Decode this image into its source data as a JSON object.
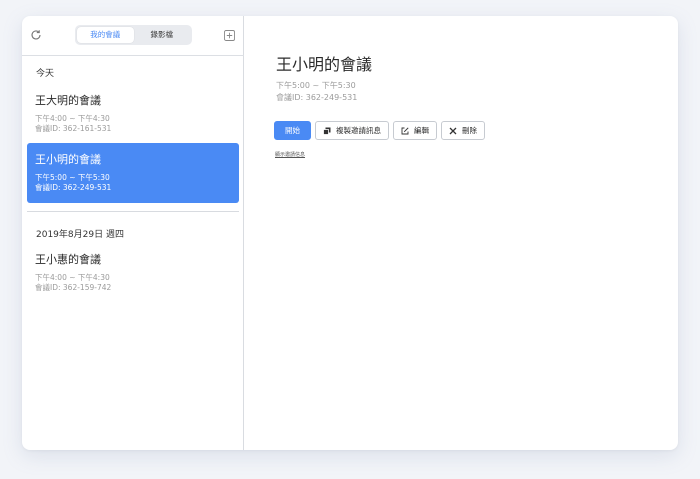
{
  "sidebar": {
    "tabs": [
      {
        "label": "我的會議"
      },
      {
        "label": "錄影檔"
      }
    ],
    "sections": [
      {
        "label": "今天",
        "meetings": [
          {
            "title": "王大明的會議",
            "time": "下午4:00 ~ 下午4:30",
            "id": "會議ID:  362-161-531"
          },
          {
            "title": "王小明的會議",
            "time": "下午5:00 ~ 下午5:30",
            "id": "會議ID:  362-249-531"
          }
        ]
      },
      {
        "label": "2019年8月29日 週四",
        "meetings": [
          {
            "title": "王小惠的會議",
            "time": "下午4:00 ~ 下午4:30",
            "id": "會議ID:  362-159-742"
          }
        ]
      }
    ]
  },
  "detail": {
    "title": "王小明的會議",
    "time": "下午5:00 ~ 下午5:30",
    "id": "會議ID:  362-249-531",
    "buttons": {
      "start": "開始",
      "copy": "複製邀請訊息",
      "edit": "編輯",
      "delete": "刪除"
    },
    "show_invite": "顯示邀請信息"
  },
  "colors": {
    "accent": "#4a8af4",
    "muted_text": "#9b9b9b"
  }
}
